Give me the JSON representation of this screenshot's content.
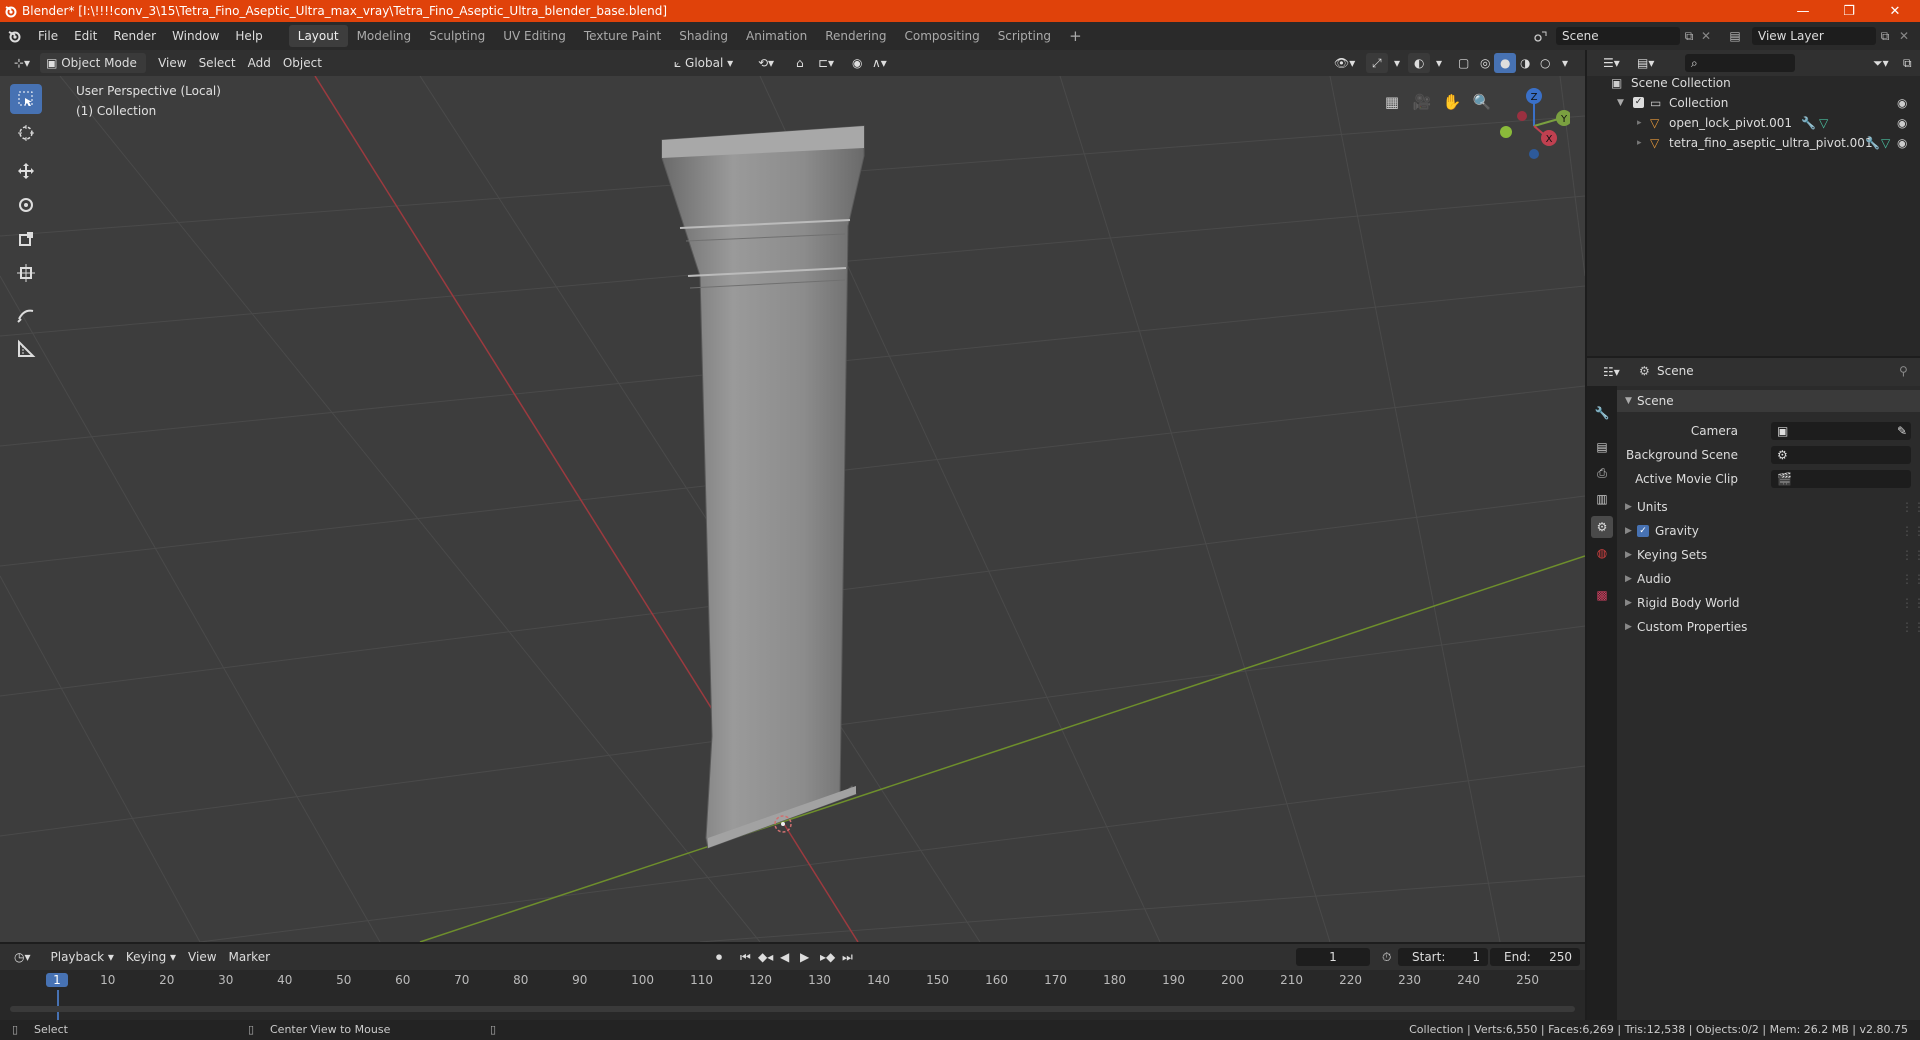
{
  "window": {
    "title": "Blender* [I:\\!!!!conv_3\\15\\Tetra_Fino_Aseptic_Ultra_max_vray\\Tetra_Fino_Aseptic_Ultra_blender_base.blend]",
    "accent_color": "#e0420a"
  },
  "menu": [
    "File",
    "Edit",
    "Render",
    "Window",
    "Help"
  ],
  "workspaces": [
    {
      "label": "Layout",
      "active": true
    },
    {
      "label": "Modeling"
    },
    {
      "label": "Sculpting"
    },
    {
      "label": "UV Editing"
    },
    {
      "label": "Texture Paint"
    },
    {
      "label": "Shading"
    },
    {
      "label": "Animation"
    },
    {
      "label": "Rendering"
    },
    {
      "label": "Compositing"
    },
    {
      "label": "Scripting"
    }
  ],
  "scene_field": "Scene",
  "view_layer_field": "View Layer",
  "viewport_header": {
    "mode": "Object Mode",
    "menus": [
      "View",
      "Select",
      "Add",
      "Object"
    ],
    "orientation": "Global"
  },
  "viewport": {
    "perspective_label": "User Perspective (Local)",
    "collection_label": "(1) Collection",
    "gizmo": {
      "x": "X",
      "y": "Y",
      "z": "Z"
    }
  },
  "outliner": {
    "root": "Scene Collection",
    "collection": "Collection",
    "objects": [
      "open_lock_pivot.001",
      "tetra_fino_aseptic_ultra_pivot.001"
    ]
  },
  "properties": {
    "header": "Scene",
    "panel_title": "Scene",
    "fields": [
      {
        "label": "Camera"
      },
      {
        "label": "Background Scene"
      },
      {
        "label": "Active Movie Clip"
      }
    ],
    "subpanels": [
      "Units",
      "Gravity",
      "Keying Sets",
      "Audio",
      "Rigid Body World",
      "Custom Properties"
    ],
    "gravity_checked": true
  },
  "timeline": {
    "menus": [
      "Playback",
      "Keying",
      "View",
      "Marker"
    ],
    "current_frame": "1",
    "start_label": "Start:",
    "start": "1",
    "end_label": "End:",
    "end": "250",
    "ruler": [
      "1",
      "10",
      "20",
      "30",
      "40",
      "50",
      "60",
      "70",
      "80",
      "90",
      "100",
      "110",
      "120",
      "130",
      "140",
      "150",
      "160",
      "170",
      "180",
      "190",
      "200",
      "210",
      "220",
      "230",
      "240",
      "250"
    ]
  },
  "statusbar": {
    "select": "Select",
    "center_view": "Center View to Mouse",
    "stats": "Collection | Verts:6,550 | Faces:6,269 | Tris:12,538 | Objects:0/2 | Mem: 26.2 MB | v2.80.75"
  }
}
